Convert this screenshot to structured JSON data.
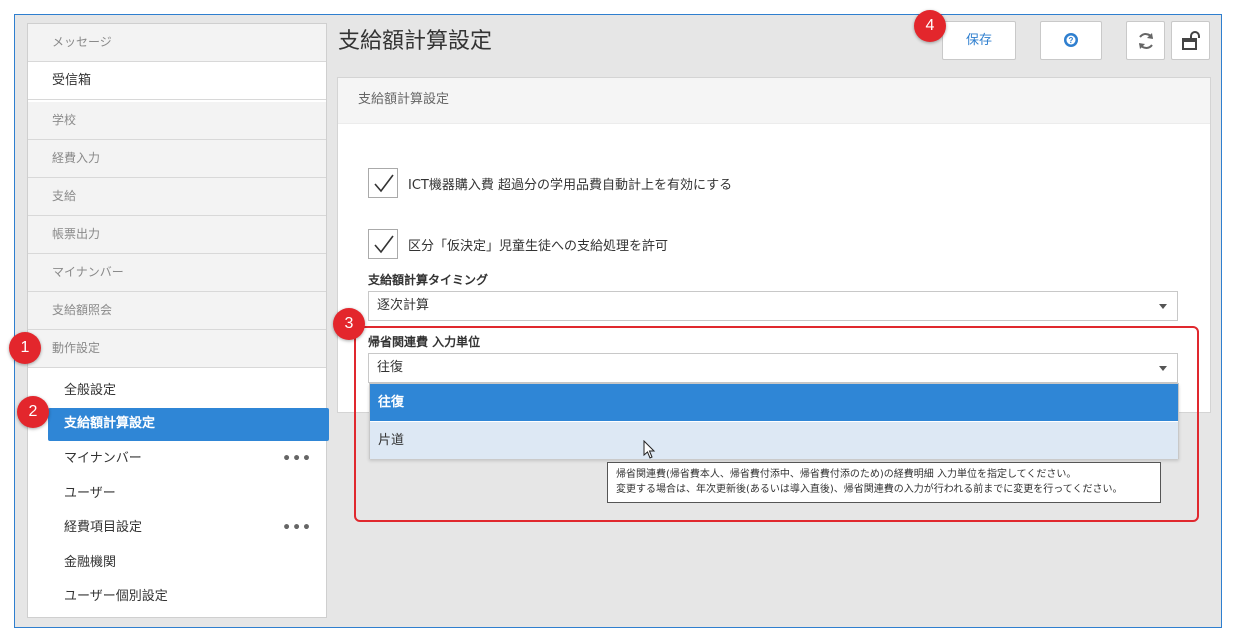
{
  "header": {
    "title": "支給額計算設定",
    "save_label": "保存",
    "help_icon": "help-icon",
    "refresh_icon": "refresh-icon",
    "unlock_icon": "unlock-icon"
  },
  "sidebar": {
    "sections": [
      {
        "label": "メッセージ"
      },
      {
        "label": "受信箱"
      },
      {
        "label": "学校"
      },
      {
        "label": "経費入力"
      },
      {
        "label": "支給"
      },
      {
        "label": "帳票出力"
      },
      {
        "label": "マイナンバー"
      },
      {
        "label": "支給額照会"
      },
      {
        "label": "動作設定"
      }
    ],
    "items": [
      {
        "label": "全般設定"
      },
      {
        "label": "支給額計算設定"
      },
      {
        "label": "マイナンバー",
        "more": "•••"
      },
      {
        "label": "ユーザー"
      },
      {
        "label": "経費項目設定",
        "more": "•••"
      },
      {
        "label": "金融機関"
      },
      {
        "label": "ユーザー個別設定"
      }
    ]
  },
  "panel": {
    "title": "支給額計算設定",
    "checkbox1": {
      "label": "ICT機器購入費 超過分の学用品費自動計上を有効にする",
      "checked": true
    },
    "checkbox2": {
      "label": "区分「仮決定」児童生徒への支給処理を許可",
      "checked": true
    },
    "timing": {
      "label": "支給額計算タイミング",
      "value": "逐次計算"
    },
    "unit": {
      "label": "帰省関連費 入力単位",
      "value": "往復",
      "options": [
        "往復",
        "片道"
      ]
    },
    "tooltip": {
      "line1": "帰省関連費(帰省費本人、帰省費付添中、帰省費付添のため)の経費明細 入力単位を指定してください。",
      "line2": "変更する場合は、年次更新後(あるいは導入直後)、帰省関連費の入力が行われる前までに変更を行ってください。"
    }
  },
  "annotations": {
    "badges": [
      "1",
      "2",
      "3",
      "4"
    ],
    "highlight_color": "#e0282e",
    "accent_color": "#2f86d6"
  }
}
